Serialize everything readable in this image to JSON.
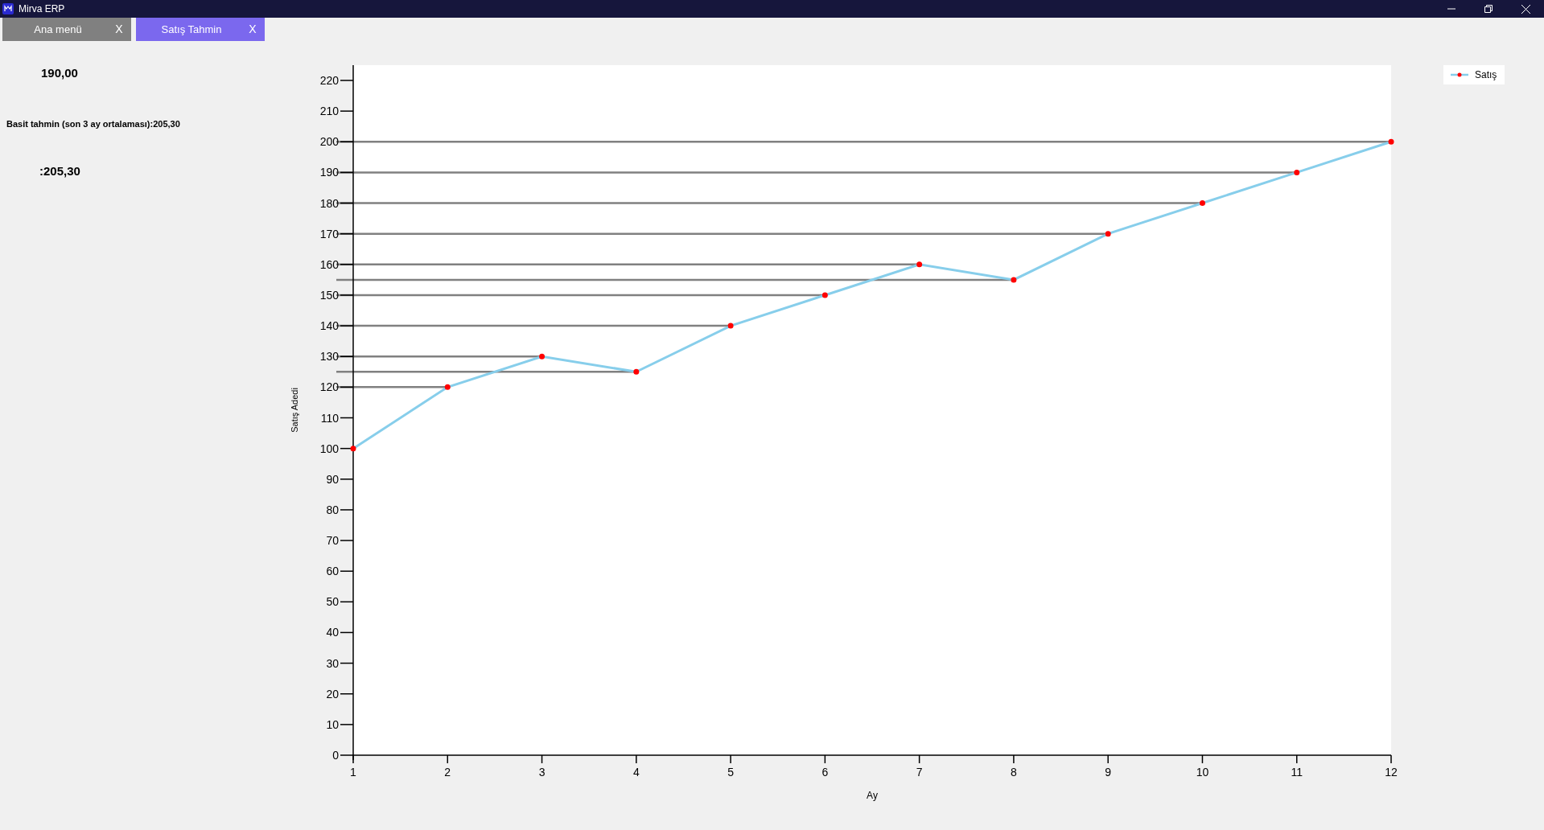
{
  "window": {
    "title": "Mirva ERP"
  },
  "tabs": [
    {
      "label": "Ana menü",
      "close": "X",
      "selected": false
    },
    {
      "label": "Satış Tahmin",
      "close": "X",
      "selected": true
    }
  ],
  "summary": {
    "last_value": "190,00",
    "forecast_text": "Basit tahmin (son 3 ay ortalaması):205,30",
    "forecast_value": ":205,30"
  },
  "chart_data": {
    "type": "line",
    "xlabel": "Ay",
    "ylabel": "Satış Adedi",
    "categories": [
      "1",
      "2",
      "3",
      "4",
      "5",
      "6",
      "7",
      "8",
      "9",
      "10",
      "11",
      "12"
    ],
    "ref_lines": [
      {
        "axis": "y",
        "value": 120
      },
      {
        "axis": "y",
        "value": 130
      },
      {
        "axis": "y",
        "value": 125
      },
      {
        "axis": "y",
        "value": 140
      },
      {
        "axis": "y",
        "value": 150
      },
      {
        "axis": "y",
        "value": 160
      },
      {
        "axis": "y",
        "value": 155
      },
      {
        "axis": "y",
        "value": 170
      },
      {
        "axis": "y",
        "value": 180
      },
      {
        "axis": "y",
        "value": 190
      },
      {
        "axis": "y",
        "value": 200
      }
    ],
    "series": [
      {
        "name": "Satış",
        "color": "#87ceeb",
        "marker": "o",
        "values": [
          100,
          120,
          130,
          125,
          140,
          150,
          160,
          155,
          170,
          180,
          190,
          200
        ]
      }
    ],
    "ylim": [
      0,
      225
    ],
    "yticks": [
      0,
      10,
      20,
      30,
      40,
      50,
      60,
      70,
      80,
      90,
      100,
      110,
      120,
      130,
      140,
      150,
      160,
      170,
      180,
      190,
      200,
      210,
      220
    ]
  }
}
